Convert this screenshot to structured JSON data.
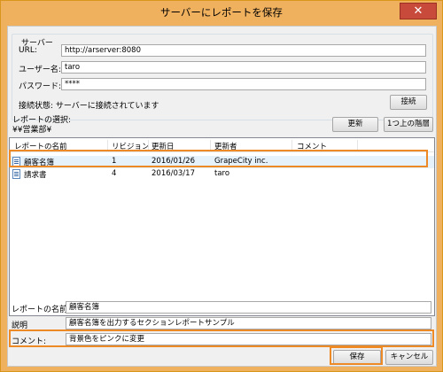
{
  "window": {
    "title": "サーバーにレポートを保存",
    "close_glyph": "✕"
  },
  "server": {
    "group_label": "サーバー",
    "url_label": "URL:",
    "url_value": "http://arserver:8080",
    "username_label": "ユーザー名:",
    "username_value": "taro",
    "password_label": "パスワード:",
    "password_value": "****",
    "status_text": "接続状態: サーバーに接続されています",
    "connect_button": "接続"
  },
  "report_select": {
    "label": "レポートの選択:",
    "path": "¥¥営業部¥",
    "refresh_button": "更新",
    "up_button": "1つ上の階層"
  },
  "list": {
    "columns": [
      "レポートの名前",
      "リビジョン",
      "更新日",
      "更新者",
      "コメント"
    ],
    "rows": [
      {
        "name": "顧客名簿",
        "revision": "1",
        "date": "2016/01/26",
        "author": "GrapeCity inc.",
        "comment": "",
        "selected": true
      },
      {
        "name": "請求書",
        "revision": "4",
        "date": "2016/03/17",
        "author": "taro",
        "comment": "",
        "selected": false
      }
    ]
  },
  "form": {
    "name_label": "レポートの名前:",
    "name_value": "顧客名簿",
    "desc_label": "説明",
    "desc_value": "顧客名簿を出力するセクションレポートサンプル",
    "comment_label": "コメント:",
    "comment_value": "背景色をピンクに変更"
  },
  "buttons": {
    "save": "保存",
    "cancel": "キャンセル"
  },
  "colors": {
    "highlight": "#ee8a25",
    "selection": "#e5f1fb",
    "frame": "#f0b15f"
  }
}
